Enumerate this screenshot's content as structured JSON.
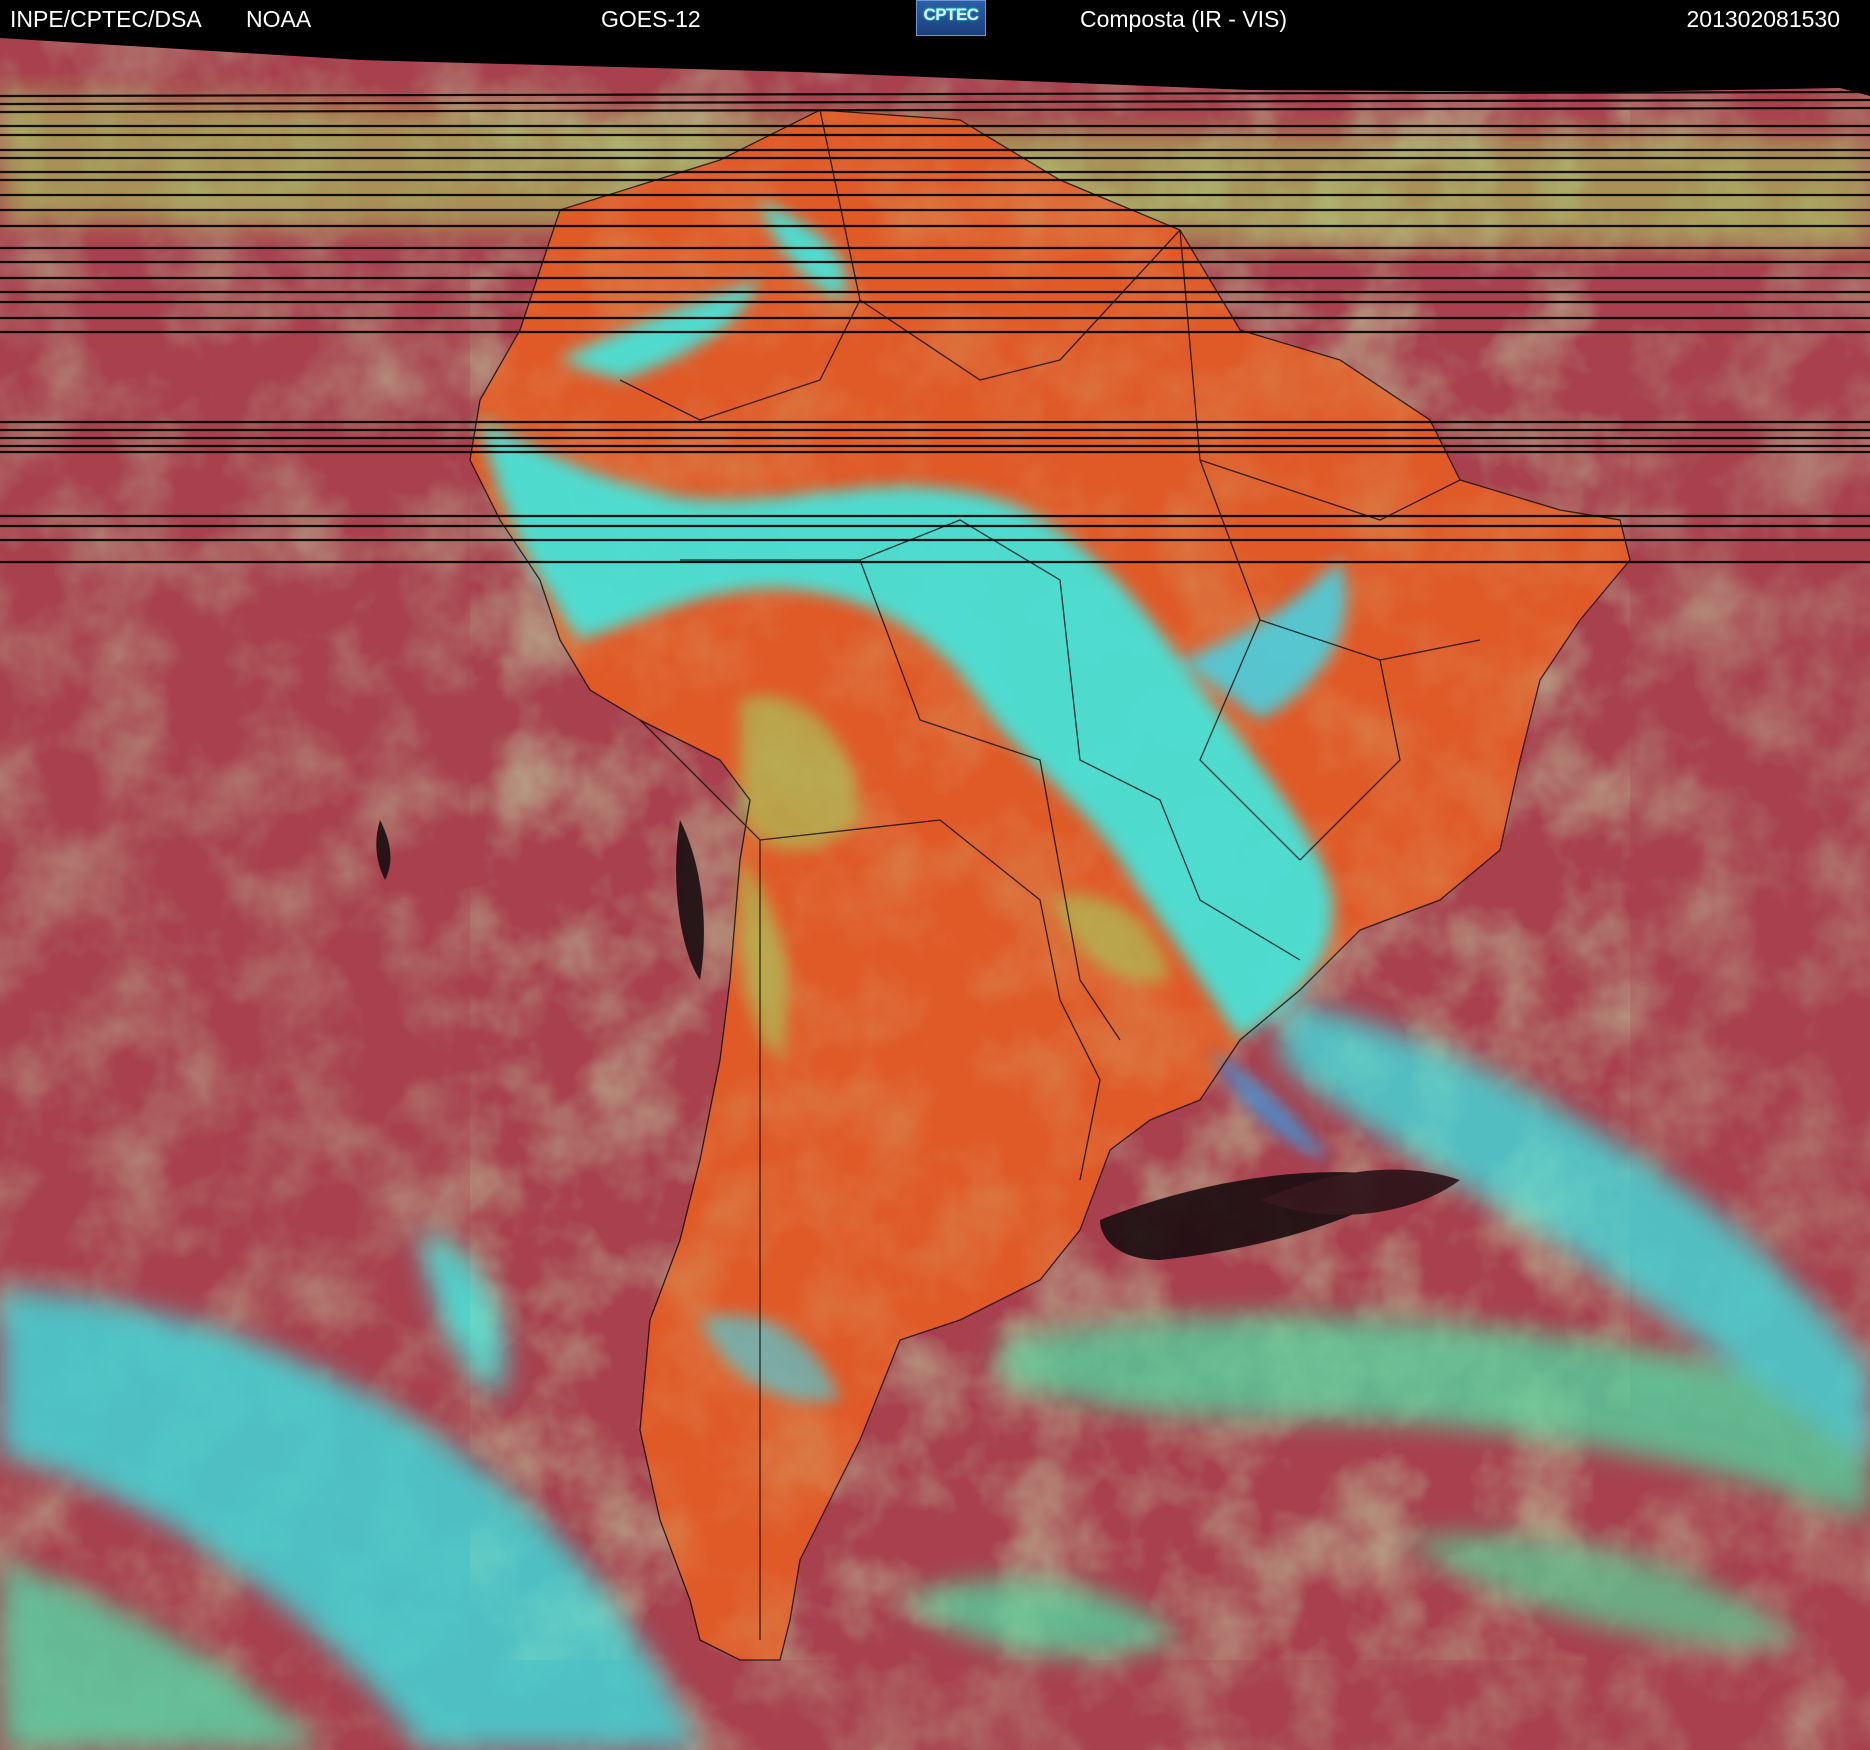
{
  "header": {
    "organization": "INPE/CPTEC/DSA",
    "agency": "NOAA",
    "satellite": "GOES-12",
    "logo_text": "CPTEC",
    "product": "Composta (IR - VIS)",
    "timestamp": "201302081530"
  },
  "colors": {
    "ocean": "#a8404e",
    "land_clear": "#e05a28",
    "cloud_low": "#a7c85c",
    "cloud_high": "#3fe8e0",
    "cloud_mid": "#4a90d0",
    "background": "#000000",
    "header_text": "#ffffff"
  }
}
